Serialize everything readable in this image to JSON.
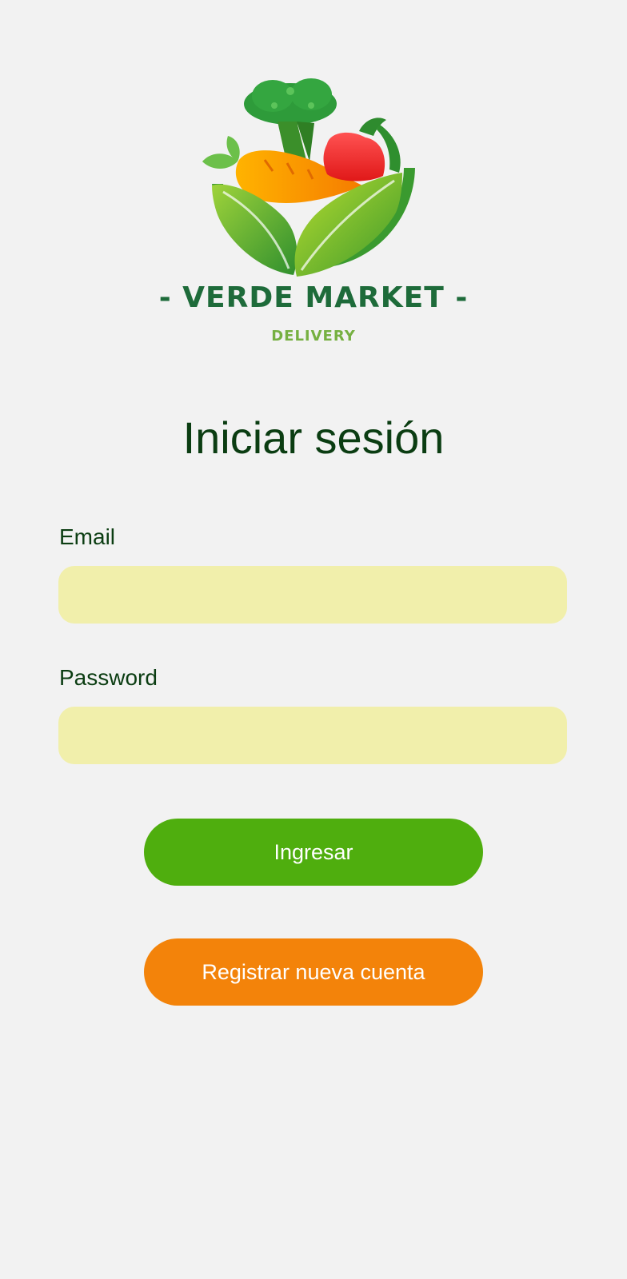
{
  "brand": {
    "name": "- VERDE MARKET -",
    "tagline": "DELIVERY"
  },
  "login": {
    "title": "Iniciar sesión",
    "email": {
      "label": "Email",
      "value": "",
      "placeholder": ""
    },
    "password": {
      "label": "Password",
      "value": "",
      "placeholder": ""
    },
    "submit_label": "Ingresar",
    "register_label": "Registrar nueva cuenta"
  },
  "colors": {
    "background": "#f2f2f2",
    "title_text": "#0b3d12",
    "input_fill": "#f1efab",
    "primary_button": "#4fae0e",
    "secondary_button": "#f3830a",
    "brand_dark_green": "#1e6b3a",
    "brand_light_green": "#76b041"
  }
}
